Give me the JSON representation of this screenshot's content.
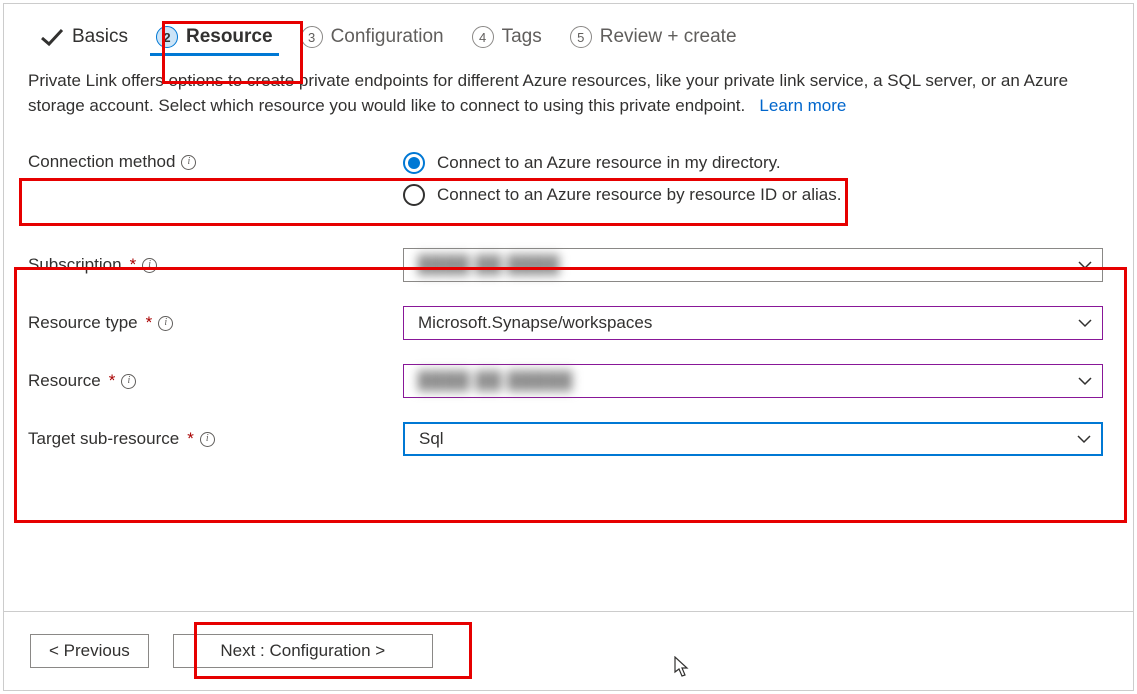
{
  "tabs": {
    "basics": "Basics",
    "resource_num": "2",
    "resource": "Resource",
    "config_num": "3",
    "config": "Configuration",
    "tags_num": "4",
    "tags": "Tags",
    "review_num": "5",
    "review": "Review + create"
  },
  "desc": {
    "text": "Private Link offers options to create private endpoints for different Azure resources, like your private link service, a SQL server, or an Azure storage account. Select which resource you would like to connect to using this private endpoint.",
    "learn_more": "Learn more"
  },
  "connection_method": {
    "label": "Connection method",
    "opt1": "Connect to an Azure resource in my directory.",
    "opt2": "Connect to an Azure resource by resource ID or alias."
  },
  "fields": {
    "subscription_label": "Subscription",
    "subscription_value": "████ ██ ████",
    "resource_type_label": "Resource type",
    "resource_type_value": "Microsoft.Synapse/workspaces",
    "resource_label": "Resource",
    "resource_value": "████ ██ █████",
    "target_label": "Target sub-resource",
    "target_value": "Sql"
  },
  "buttons": {
    "previous": "< Previous",
    "next": "Next : Configuration >"
  }
}
